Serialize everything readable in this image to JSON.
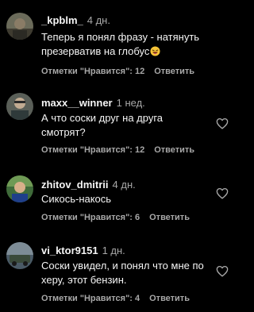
{
  "comments": [
    {
      "username": "_kpblm_",
      "time": "4 дн.",
      "text": "Теперь я понял фразу - натянуть презерватив на глобус",
      "emoji": "laughing-face-emoji",
      "likes_label": "Отметки \"Нравится\": 12",
      "reply_label": "Ответить",
      "avatar_color": "#6b6b5a"
    },
    {
      "username": "maxx__winner",
      "time": "1 нед.",
      "text": "А что соски друг на друга смотрят?",
      "likes_label": "Отметки \"Нравится\": 12",
      "reply_label": "Ответить",
      "avatar_color": "#5a5f58"
    },
    {
      "username": "zhitov_dmitrii",
      "time": "4 дн.",
      "text": "Сикось-накось",
      "likes_label": "Отметки \"Нравится\": 6",
      "reply_label": "Ответить",
      "avatar_color": "#3f6b3a"
    },
    {
      "username": "vi_ktor9151",
      "time": "1 дн.",
      "text": "Соски увидел, и понял что мне по херу, этот бензин.",
      "likes_label": "Отметки \"Нравится\": 4",
      "reply_label": "Ответить",
      "avatar_color": "#4a5a66"
    }
  ],
  "colors": {
    "background": "#000000",
    "primary_text": "#f5f5f5",
    "secondary_text": "#a8a8a8"
  },
  "icons": {
    "like": "heart-outline-icon"
  }
}
